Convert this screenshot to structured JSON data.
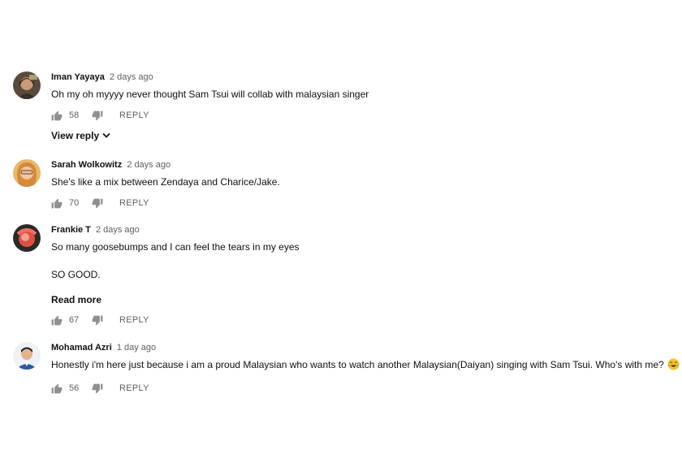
{
  "comments": [
    {
      "author": "Iman Yayaya",
      "time": "2 days ago",
      "text": "Oh my oh myyyy never thought Sam Tsui will collab with malaysian singer",
      "likes": "58",
      "reply_label": "REPLY",
      "view_reply_label": "View reply",
      "avatar_color": "#6b5a4a"
    },
    {
      "author": "Sarah Wolkowitz",
      "time": "2 days ago",
      "text": "She's like a mix between Zendaya and Charice/Jake.",
      "likes": "70",
      "reply_label": "REPLY",
      "avatar_color": "#d9a35a"
    },
    {
      "author": "Frankie T",
      "time": "2 days ago",
      "text_line1": "So many goosebumps and I can feel the tears in my eyes",
      "text_line2": "SO GOOD.",
      "read_more_label": "Read more",
      "likes": "67",
      "reply_label": "REPLY",
      "avatar_color": "#c0392b"
    },
    {
      "author": "Mohamad Azri",
      "time": "1 day ago",
      "text": "Honestly i'm here just because i am a proud Malaysian who wants to watch another Malaysian(Daiyan) singing with Sam Tsui. Who's with me?",
      "emoji": "tears-of-joy-emoji",
      "likes": "56",
      "reply_label": "REPLY",
      "avatar_color": "#e8eef5"
    }
  ],
  "icons": {
    "like": "thumb-up-icon",
    "dislike": "thumb-down-icon",
    "chevron": "chevron-down-icon"
  },
  "colors": {
    "text": "#0f0f0f",
    "secondary": "#606060"
  }
}
